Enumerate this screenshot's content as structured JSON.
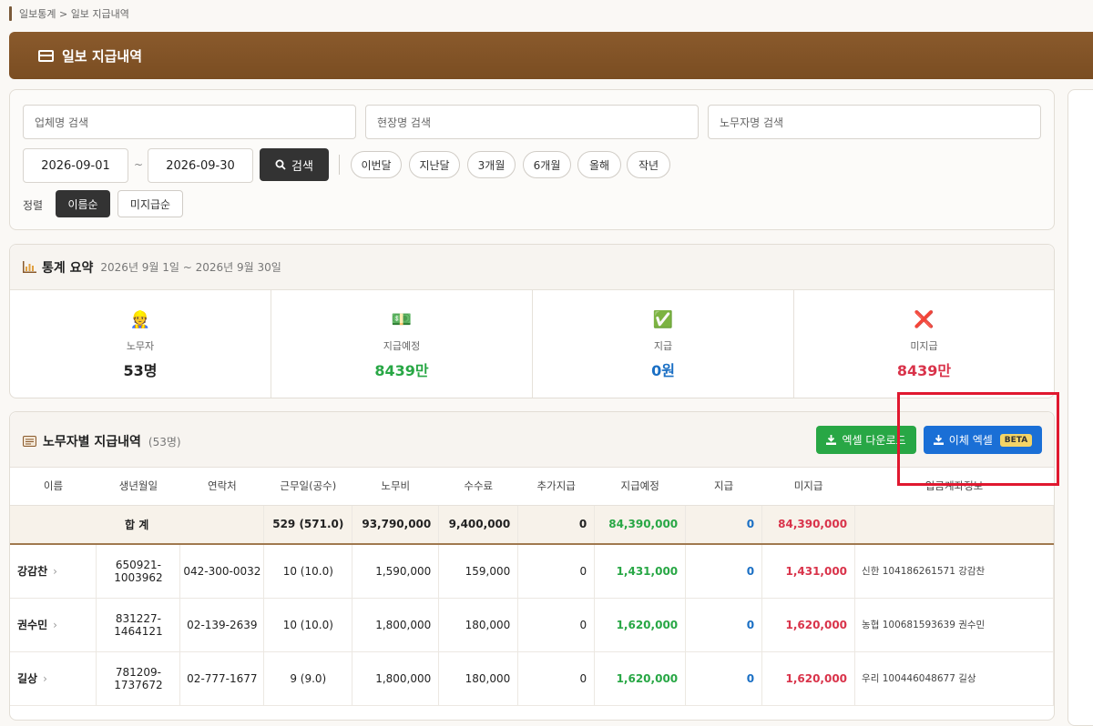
{
  "breadcrumb": "일보통계 > 일보 지급내역",
  "header": {
    "title": "일보 지급내역",
    "icon": "credit-card-icon"
  },
  "filter": {
    "company_placeholder": "업체명 검색",
    "site_placeholder": "현장명 검색",
    "worker_placeholder": "노무자명 검색",
    "date_from": "2026-09-01",
    "date_sep": "~",
    "date_to": "2026-09-30",
    "search_label": "검색",
    "presets": [
      "이번달",
      "지난달",
      "3개월",
      "6개월",
      "올해",
      "작년"
    ],
    "sort_label": "정렬",
    "sort_name": "이름순",
    "sort_unpaid": "미지급순"
  },
  "stats": {
    "title": "통계 요약",
    "period": "2026년 9월 1일 ~ 2026년 9월 30일",
    "items": [
      {
        "icon": "👷",
        "label": "노무자",
        "value": "53명",
        "color": "#222222"
      },
      {
        "icon": "💵",
        "label": "지급예정",
        "value": "8439만",
        "color": "#28a745"
      },
      {
        "icon": "✅",
        "label": "지급",
        "value": "0원",
        "color": "#1a6fc4"
      },
      {
        "icon": "❌",
        "label": "미지급",
        "value": "8439만",
        "color": "#d9334a"
      }
    ]
  },
  "list": {
    "title": "노무자별 지급내역",
    "count": "(53명)",
    "excel_download": "엑셀 다운로드",
    "transfer_excel": "이체 엑셀",
    "beta": "BETA",
    "columns": [
      "이름",
      "생년월일",
      "연락처",
      "근무일(공수)",
      "노무비",
      "수수료",
      "추가지급",
      "지급예정",
      "지급",
      "미지급",
      "입금계좌정보"
    ],
    "sum": {
      "label": "합 계",
      "workdays": "529 (571.0)",
      "labor": "93,790,000",
      "fee": "9,400,000",
      "extra": "0",
      "scheduled": "84,390,000",
      "paid": "0",
      "unpaid": "84,390,000"
    },
    "rows": [
      {
        "name": "강감찬",
        "birth": "650921-1003962",
        "phone": "042-300-0032",
        "workdays": "10 (10.0)",
        "labor": "1,590,000",
        "fee": "159,000",
        "extra": "0",
        "scheduled": "1,431,000",
        "paid": "0",
        "unpaid": "1,431,000",
        "account": "신한 104186261571 강감찬"
      },
      {
        "name": "권수민",
        "birth": "831227-1464121",
        "phone": "02-139-2639",
        "workdays": "10 (10.0)",
        "labor": "1,800,000",
        "fee": "180,000",
        "extra": "0",
        "scheduled": "1,620,000",
        "paid": "0",
        "unpaid": "1,620,000",
        "account": "농협 100681593639 권수민"
      },
      {
        "name": "길상",
        "birth": "781209-1737672",
        "phone": "02-777-1677",
        "workdays": "9 (9.0)",
        "labor": "1,800,000",
        "fee": "180,000",
        "extra": "0",
        "scheduled": "1,620,000",
        "paid": "0",
        "unpaid": "1,620,000",
        "account": "우리 100446048677 길상"
      }
    ]
  }
}
